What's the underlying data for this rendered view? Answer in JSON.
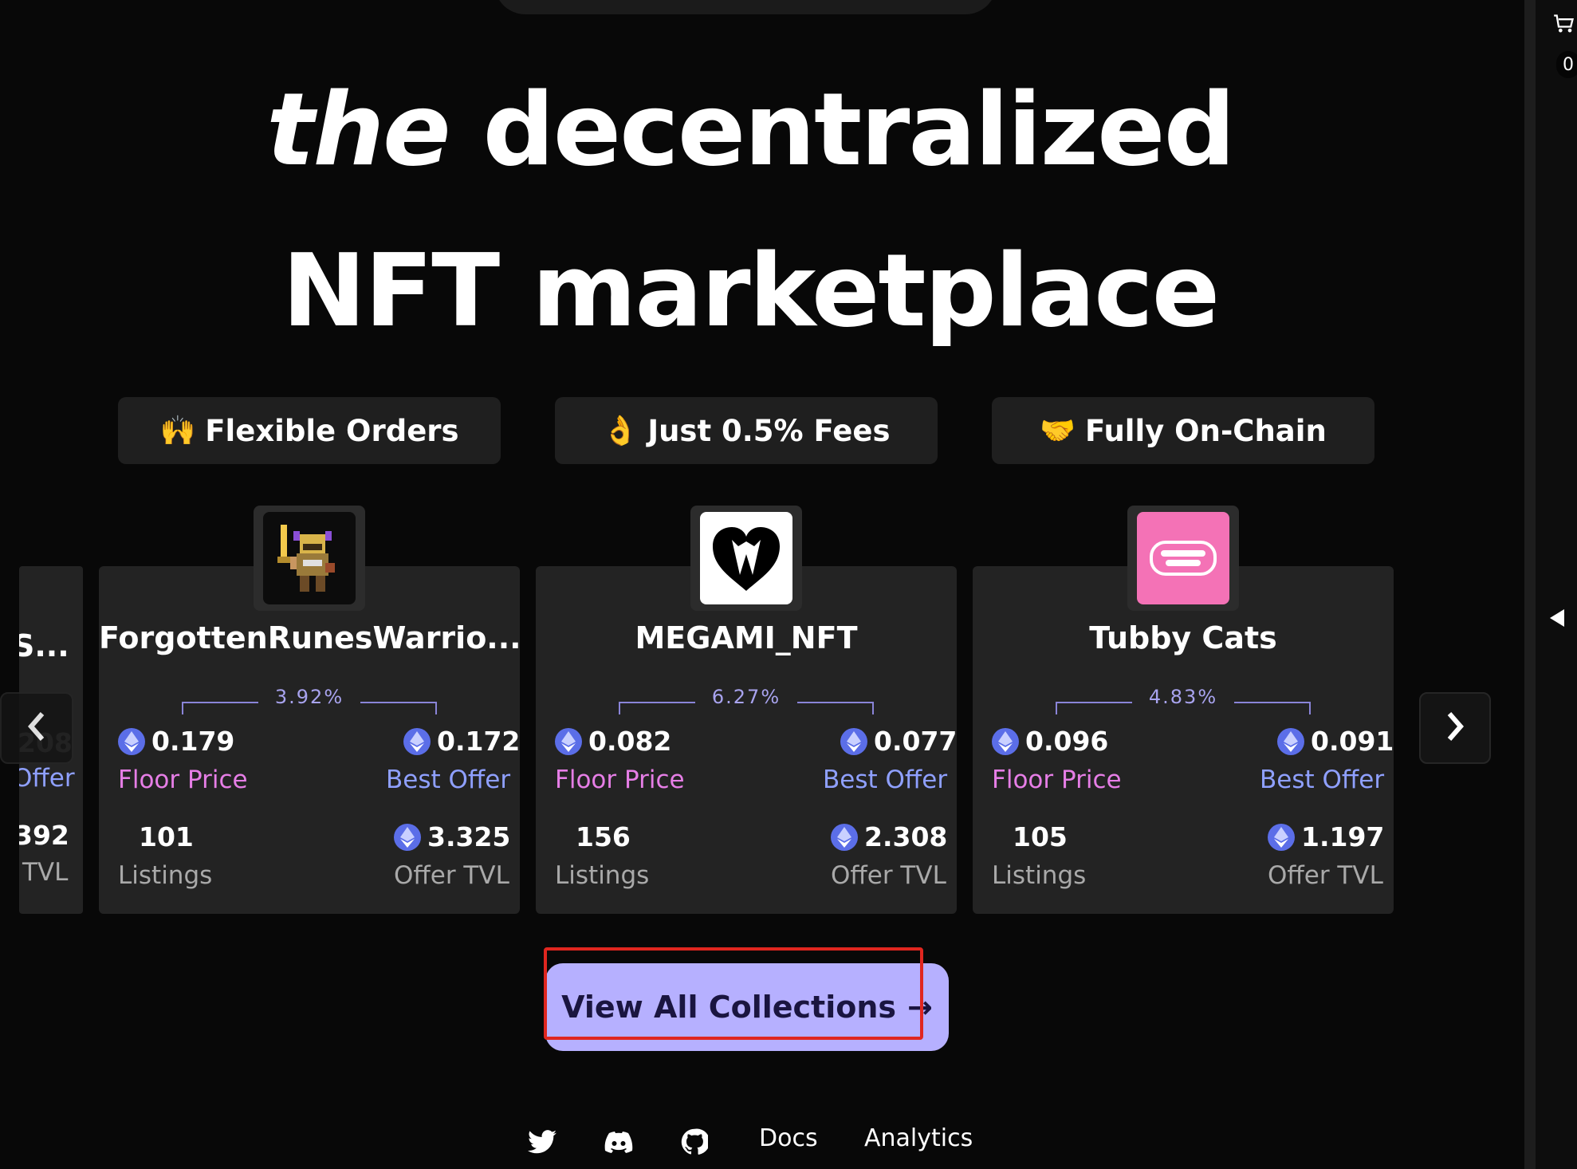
{
  "hero": {
    "title_italic": "the",
    "title_line1": "decentralized",
    "title_line2": "NFT marketplace"
  },
  "features": [
    {
      "emoji": "🙌",
      "label": "Flexible Orders"
    },
    {
      "emoji": "👌",
      "label": "Just 0.5% Fees"
    },
    {
      "emoji": "🤝",
      "label": "Fully On-Chain"
    }
  ],
  "partial_card": {
    "name": "S...",
    "best_offer": "208",
    "best_offer_label": "Offer",
    "offer_tvl": "392",
    "offer_tvl_label": "TVL"
  },
  "collections": [
    {
      "name": "ForgottenRunesWarrio...",
      "pct": "3.92%",
      "floor_price": "0.179",
      "floor_label": "Floor Price",
      "best_offer": "0.172",
      "best_offer_label": "Best Offer",
      "listings": "101",
      "listings_label": "Listings",
      "offer_tvl": "3.325",
      "offer_tvl_label": "Offer TVL"
    },
    {
      "name": "MEGAMI_NFT",
      "pct": "6.27%",
      "floor_price": "0.082",
      "floor_label": "Floor Price",
      "best_offer": "0.077",
      "best_offer_label": "Best Offer",
      "listings": "156",
      "listings_label": "Listings",
      "offer_tvl": "2.308",
      "offer_tvl_label": "Offer TVL"
    },
    {
      "name": "Tubby Cats",
      "pct": "4.83%",
      "floor_price": "0.096",
      "floor_label": "Floor Price",
      "best_offer": "0.091",
      "best_offer_label": "Best Offer",
      "listings": "105",
      "listings_label": "Listings",
      "offer_tvl": "1.197",
      "offer_tvl_label": "Offer TVL"
    }
  ],
  "cta": {
    "label": "View All Collections",
    "arrow": "→"
  },
  "footer": {
    "docs": "Docs",
    "analytics": "Analytics"
  },
  "sidebar": {
    "cart_count": "0"
  },
  "colors": {
    "accent": "#b6b0ff",
    "floor": "#e67ee6",
    "offer": "#8fa0ff",
    "highlight": "#e0261f"
  }
}
